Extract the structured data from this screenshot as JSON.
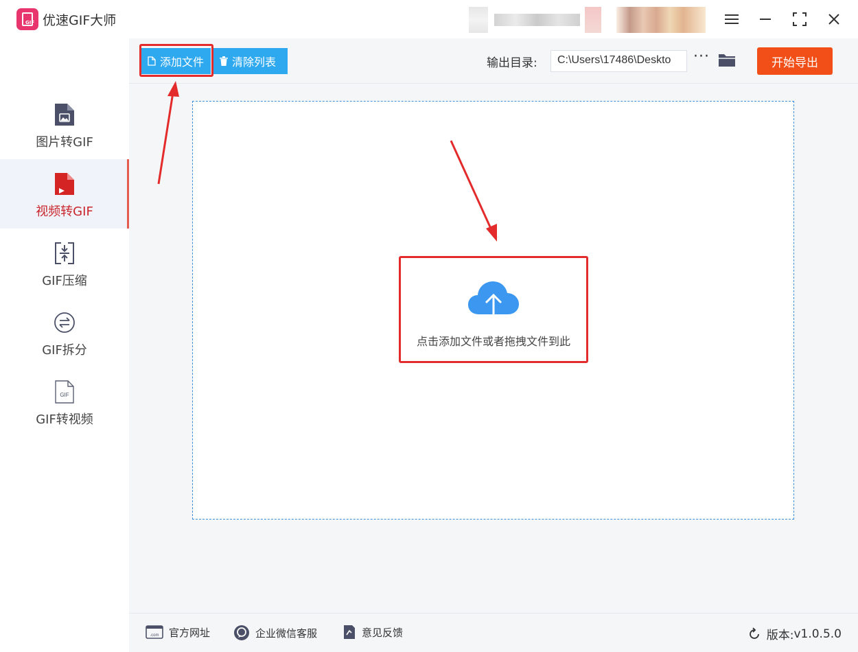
{
  "window": {
    "title": "优速GIF大师",
    "logo_text": "GIF"
  },
  "sidebar": {
    "items": [
      {
        "label": "图片转GIF",
        "icon": "image-file-icon",
        "active": false
      },
      {
        "label": "视频转GIF",
        "icon": "video-file-icon",
        "active": true
      },
      {
        "label": "GIF压缩",
        "icon": "compress-icon",
        "active": false
      },
      {
        "label": "GIF拆分",
        "icon": "split-icon",
        "active": false
      },
      {
        "label": "GIF转视频",
        "icon": "gif-file-icon",
        "active": false,
        "icon_text": "GIF"
      }
    ]
  },
  "toolbar": {
    "add_file_label": "添加文件",
    "clear_list_label": "清除列表",
    "output_dir_label": "输出目录:",
    "output_dir_value": "C:\\Users\\17486\\Deskto",
    "more_label": "···",
    "export_label": "开始导出"
  },
  "dropzone": {
    "hint": "点击添加文件或者拖拽文件到此"
  },
  "footer": {
    "website_label": "官方网址",
    "website_icon_text": ".com",
    "wechat_label": "企业微信客服",
    "feedback_label": "意见反馈",
    "version_label": "版本:",
    "version_value": "v1.0.5.0"
  },
  "colors": {
    "accent_blue": "#2ea9f0",
    "export_orange": "#f24e17",
    "highlight_red": "#e32b2b",
    "active_text": "#c9242b",
    "logo_pink": "#e8356d"
  }
}
